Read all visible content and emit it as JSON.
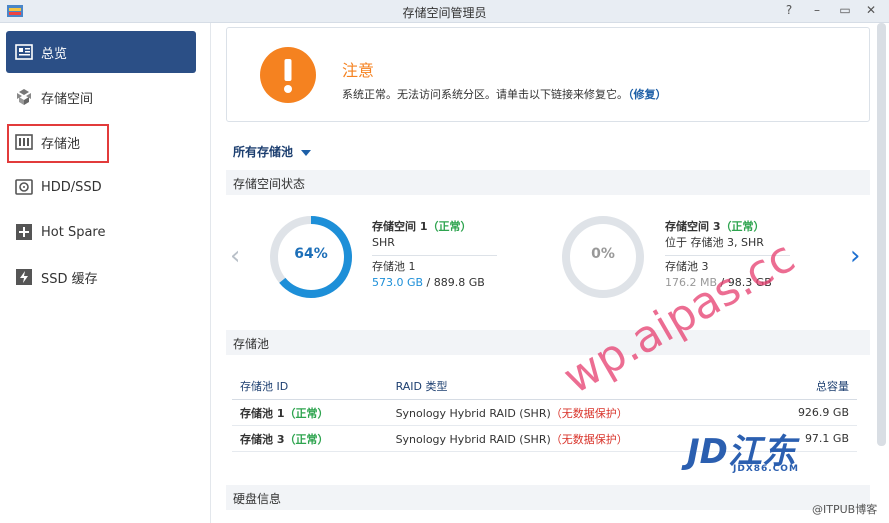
{
  "window": {
    "title": "存储空间管理员"
  },
  "sidebar": {
    "items": [
      {
        "label": "总览",
        "icon": "overview-icon"
      },
      {
        "label": "存储空间",
        "icon": "volume-icon"
      },
      {
        "label": "存储池",
        "icon": "storage-pool-icon"
      },
      {
        "label": "HDD/SSD",
        "icon": "disk-icon"
      },
      {
        "label": "Hot Spare",
        "icon": "hot-spare-icon"
      },
      {
        "label": "SSD 缓存",
        "icon": "ssd-cache-icon"
      }
    ]
  },
  "notice": {
    "title": "注意",
    "text": "系统正常。无法访问系统分区。请单击以下链接来修复它。",
    "link": "（修复）"
  },
  "filter": {
    "label": "所有存储池"
  },
  "volume_status": {
    "header": "存储空间状态",
    "volumes": [
      {
        "name": "存储空间 1",
        "status": "（正常）",
        "type": "SHR",
        "pool": "存储池 1",
        "used": "573.0 GB",
        "total": " / 889.8 GB",
        "percent": "64%",
        "fraction": 0.64
      },
      {
        "name": "存储空间 3",
        "status": "（正常）",
        "type": "位于 存储池 3, SHR",
        "pool": "存储池 3",
        "used": "176.2 MB",
        "total": " / 98.3 GB",
        "percent": "0%",
        "fraction": 0.0
      }
    ]
  },
  "pools": {
    "header": "存储池",
    "columns": [
      "存储池 ID",
      "RAID 类型",
      "总容量"
    ],
    "rows": [
      {
        "id": "存储池 1",
        "status": "（正常）",
        "raid": "Synology Hybrid RAID (SHR)",
        "warning": "（无数据保护）",
        "capacity": "926.9 GB"
      },
      {
        "id": "存储池 3",
        "status": "（正常）",
        "raid": "Synology Hybrid RAID (SHR)",
        "warning": "（无数据保护）",
        "capacity": "97.1 GB"
      }
    ]
  },
  "disk_info": {
    "header": "硬盘信息"
  },
  "watermarks": {
    "site": "wp.aipas.cc",
    "logo": "JD江东",
    "logo_sub": "JDX86.COM",
    "credit": "@ITPUB博客"
  },
  "colors": {
    "accent": "#2b4f86",
    "warning": "#f58220",
    "ok": "#2ea44f",
    "danger": "#d9342b",
    "used": "#1d8fd8"
  }
}
